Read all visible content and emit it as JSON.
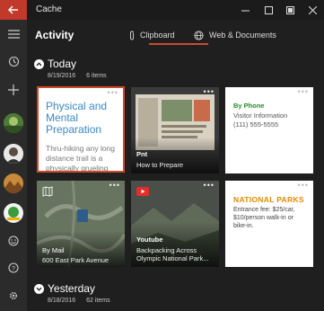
{
  "window": {
    "title": "Cache",
    "controls": [
      "minimize-icon",
      "maximize-icon",
      "snap-icon",
      "close-icon"
    ]
  },
  "header": {
    "title": "Activity",
    "tabs": [
      {
        "label": "Clipboard",
        "icon": "paperclip-icon",
        "active": true
      },
      {
        "label": "Web & Documents",
        "icon": "globe-icon",
        "active": false
      }
    ]
  },
  "rail": {
    "icons": [
      "menu-icon",
      "history-icon",
      "add-icon",
      "emoji-icon",
      "help-icon",
      "settings-icon"
    ]
  },
  "sections": [
    {
      "title": "Today",
      "date": "8/19/2016",
      "count": "6 items"
    },
    {
      "title": "Yesterday",
      "date": "8/18/2016",
      "count": "62 items"
    }
  ],
  "cards": {
    "c1": {
      "heading": "Physical and Mental Preparation",
      "body": "Thru-hiking any long distance trail is a physically grueling"
    },
    "c2": {
      "title": "Pnt",
      "subtitle": "How to Prepare"
    },
    "c3": {
      "kicker": "By Phone",
      "line1": "Visitor Information",
      "line2": "(111) 555-5555"
    },
    "c4": {
      "title": "By Mail",
      "subtitle": "600 East Park Avenue"
    },
    "c5": {
      "title": "Youtube",
      "subtitle": "Backpacking Across Olympic National Park..."
    },
    "c6": {
      "title": "NATIONAL PARKS",
      "body": "Entrance fee: $25/car, $10/person walk-in or bike-in."
    }
  },
  "colors": {
    "accent": "#d04a2a",
    "link_blue": "#3a88c6",
    "phone_green": "#2a8a2a",
    "parks_orange": "#e68a00"
  }
}
